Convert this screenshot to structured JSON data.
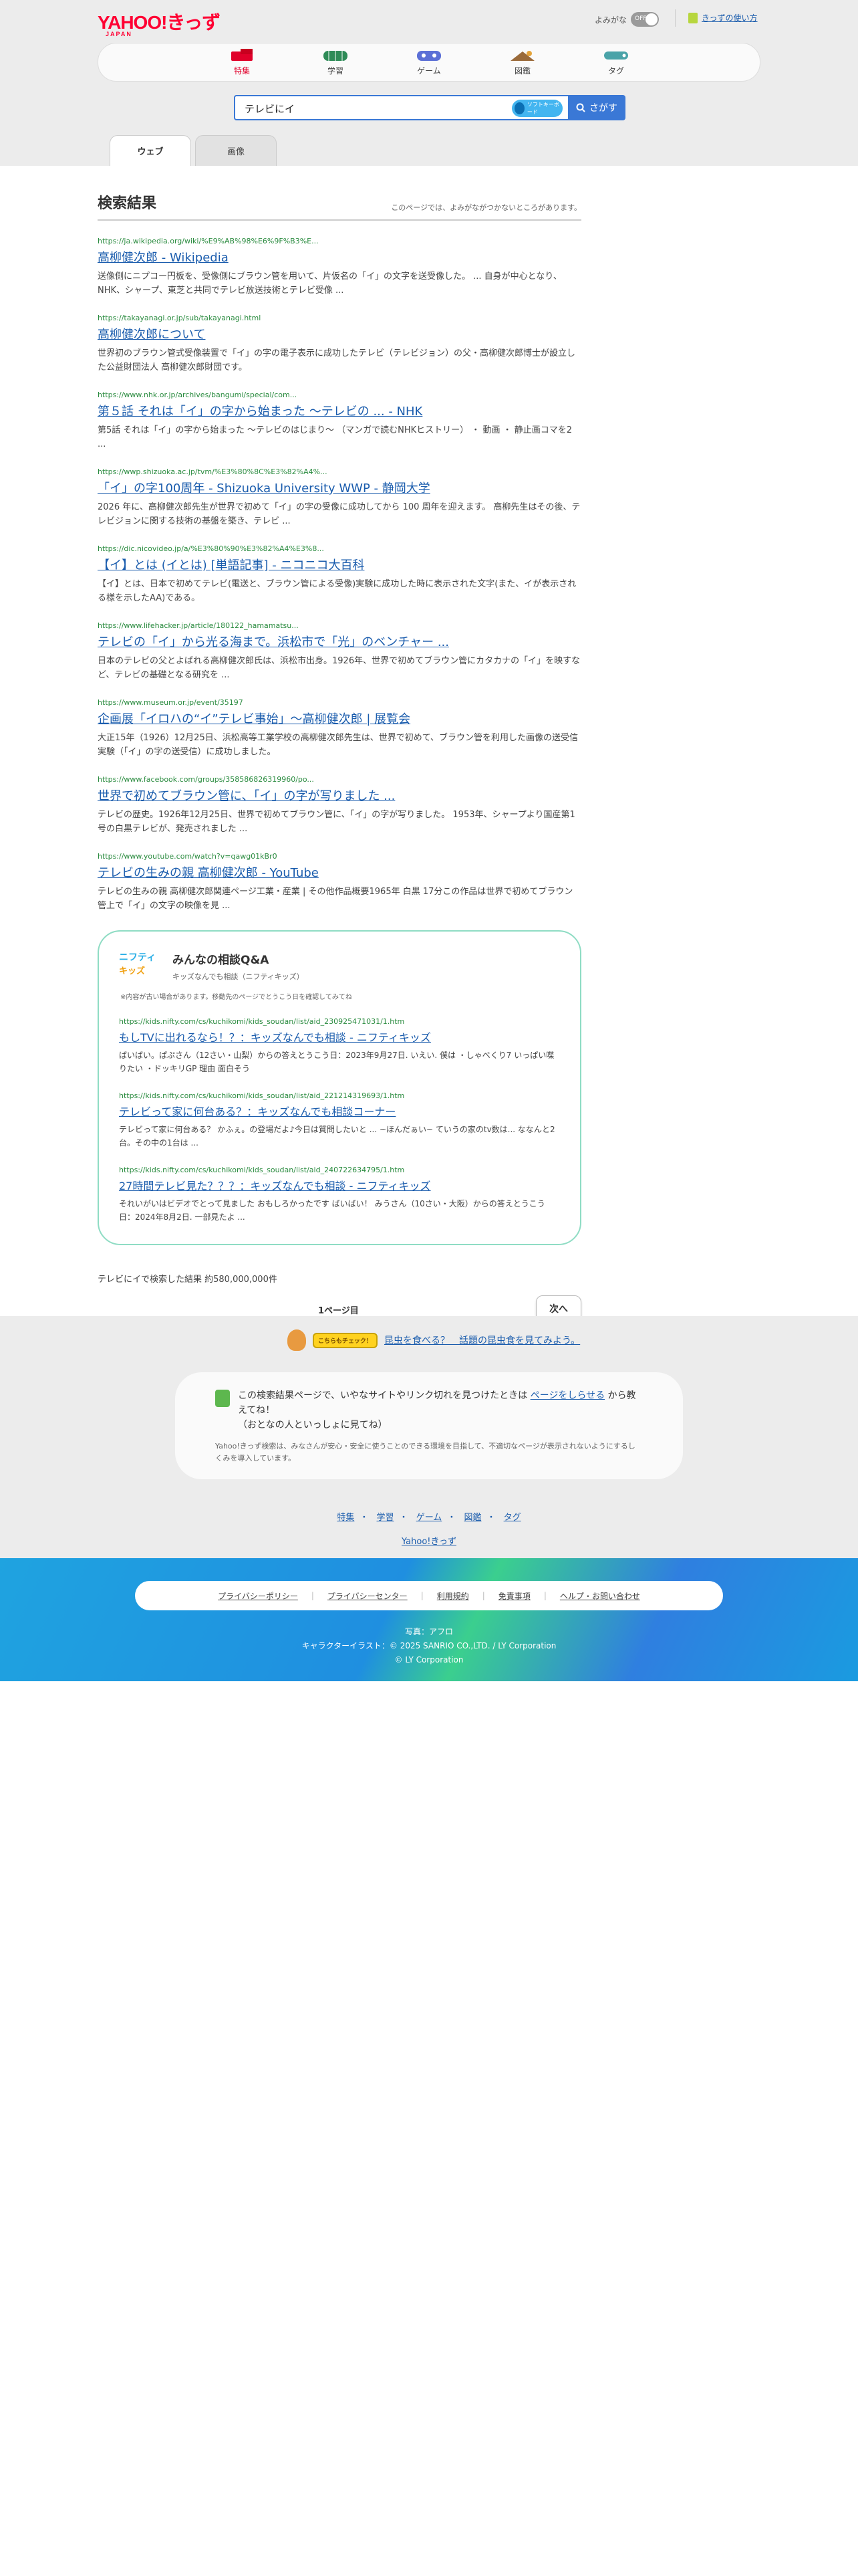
{
  "header": {
    "logo": "YAHOO!きっず",
    "logo_sub": "JAPAN",
    "furigana_label": "よみがな",
    "furigana_state": "OFF",
    "howto_label": "きっずの使い方",
    "categories": [
      {
        "label": "特集",
        "active": true
      },
      {
        "label": "学習",
        "active": false
      },
      {
        "label": "ゲーム",
        "active": false
      },
      {
        "label": "図鑑",
        "active": false
      },
      {
        "label": "タグ",
        "active": false
      }
    ]
  },
  "search": {
    "query": "テレビにイ",
    "keyboard_label": "ソフトキーボード",
    "button_label": "さがす"
  },
  "tabs": [
    "ウェブ",
    "画像"
  ],
  "results_header": {
    "title": "検索結果",
    "note": "このページでは、よみがながつかないところがあります。"
  },
  "results": [
    {
      "url": "https://ja.wikipedia.org/wiki/%E9%AB%98%E6%9F%B3%E...",
      "title": "高柳健次郎 - Wikipedia",
      "desc": "送像側にニプコー円板を、受像側にブラウン管を用いて、片仮名の「イ」の文字を送受像した。 ... 自身が中心となり、NHK、シャープ、東芝と共同でテレビ放送技術とテレビ受像 ..."
    },
    {
      "url": "https://takayanagi.or.jp/sub/takayanagi.html",
      "title": "高柳健次郎について",
      "desc": "世界初のブラウン管式受像装置で「イ」の字の電子表示に成功したテレビ（テレビジョン）の父・高柳健次郎博士が設立した公益財団法人 高柳健次郎財団です。"
    },
    {
      "url": "https://www.nhk.or.jp/archives/bangumi/special/com...",
      "title": "第５話 それは「イ」の字から始まった 〜テレビの ... - NHK",
      "desc": "第5話 それは「イ」の字から始まった 〜テレビのはじまり〜 （マンガで読むNHKヒストリー） ・ 動画 ・ 静止画コマを2 ..."
    },
    {
      "url": "https://wwp.shizuoka.ac.jp/tvm/%E3%80%8C%E3%82%A4%...",
      "title": "「イ」の字100周年 - Shizuoka University WWP - 静岡大学",
      "desc": "2026 年に、高柳健次郎先生が世界で初めて「イ」の字の受像に成功してから 100 周年を迎えます。 高柳先生はその後、テレビジョンに関する技術の基盤を築き、テレビ ..."
    },
    {
      "url": "https://dic.nicovideo.jp/a/%E3%80%90%E3%82%A4%E3%8...",
      "title": "【イ】とは (イとは) [単語記事] - ニコニコ大百科",
      "desc": "【イ】とは、日本で初めてテレビ(電送と、ブラウン管による受像)実験に成功した時に表示された文字(また、イが表示される様を示したAA)である。"
    },
    {
      "url": "https://www.lifehacker.jp/article/180122_hamamatsu...",
      "title": "テレビの「イ」から光る海まで。浜松市で「光」のベンチャー ...",
      "desc": "日本のテレビの父とよばれる高柳健次郎氏は、浜松市出身。1926年、世界で初めてブラウン管にカタカナの「イ」を映すなど、テレビの基礎となる研究を ..."
    },
    {
      "url": "https://www.museum.or.jp/event/35197",
      "title": "企画展「イロハの“イ”テレビ事始」〜高柳健次郎 | 展覧会",
      "desc": "大正15年（1926）12月25日、浜松高等工業学校の高柳健次郎先生は、世界で初めて、ブラウン管を利用した画像の送受信実験（「イ」の字の送受信）に成功しました。"
    },
    {
      "url": "https://www.facebook.com/groups/358586826319960/po...",
      "title": "世界で初めてブラウン管に、「イ」の字が写りました ...",
      "desc": "テレビの歴史。1926年12月25日、世界で初めてブラウン管に、「イ」の字が写りました。 1953年、シャープより国産第1号の白黒テレビが、発売されました ..."
    },
    {
      "url": "https://www.youtube.com/watch?v=qawg01kBr0",
      "title": "テレビの生みの親 高柳健次郎 - YouTube",
      "desc": "テレビの生みの親 高柳健次郎関連ページ工業・産業 | その他作品概要1965年 白黒 17分この作品は世界で初めてブラウン管上で「イ」の文字の映像を見 ..."
    }
  ],
  "qa": {
    "logo_top": "ニフティ",
    "logo_bottom": "キッズ",
    "title": "みんなの相談Q&A",
    "subtitle": "キッズなんでも相談（ニフティキッズ）",
    "warning": "※内容が古い場合があります。移動先のページでとうこう日を確認してみてね",
    "items": [
      {
        "url": "https://kids.nifty.com/cs/kuchikomi/kids_soudan/list/aid_230925471031/1.htm",
        "title": "もしTVに出れるなら！？：キッズなんでも相談 - ニフティキッズ",
        "desc": "ばいばい。ぱぷさん（12さい・山梨）からの答えとうこう日：2023年9月27日. いえい. 僕は ・しゃべくり7 いっぱい喋りたい ・ドッキリGP 理由 面白そう"
      },
      {
        "url": "https://kids.nifty.com/cs/kuchikomi/kids_soudan/list/aid_221214319693/1.htm",
        "title": "テレビって家に何台ある？：キッズなんでも相談コーナー",
        "desc": "テレビって家に何台ある？ かふぇ。の登場だよ♪今日は質問したいと ... ~ほんだぁい~ ていうの家のtv数は... ななんと2台。その中の1台は ..."
      },
      {
        "url": "https://kids.nifty.com/cs/kuchikomi/kids_soudan/list/aid_240722634795/1.htm",
        "title": "27時間テレビ見た？？？：キッズなんでも相談 - ニフティキッズ",
        "desc": "それいがいはビデオでとって見ました おもしろかったです ばいばい！ みうさん（10さい・大阪）からの答えとうこう日：2024年8月2日. 一部見たよ ..."
      }
    ]
  },
  "total": "テレビにイで検索した結果 約580,000,000件",
  "pager": {
    "current": "1ページ目",
    "next": "次へ"
  },
  "promo": {
    "badge": "こちらもチェック！",
    "text": "昆虫を食べる？　話題の昆虫食を見てみよう。"
  },
  "report": {
    "text_before": "この検索結果ページで、いやなサイトやリンク切れを見つけたときは",
    "link": "ページをしらせる",
    "text_after": "から教えてね！",
    "text_line2": "（おとなの人といっしょに見てね）",
    "fine": "Yahoo!きっず検索は、みなさんが安心・安全に使うことのできる環境を目指して、不適切なページが表示されないようにするしくみを導入しています。"
  },
  "footer_links": [
    "特集",
    "学習",
    "ゲーム",
    "図鑑",
    "タグ"
  ],
  "footer_home": "Yahoo!きっず",
  "footer_bar": [
    "プライバシーポリシー",
    "プライバシーセンター",
    "利用規約",
    "免責事項",
    "ヘルプ・お問い合わせ"
  ],
  "credits": [
    "写真：アフロ",
    "キャラクターイラスト：© 2025 SANRIO CO.,LTD. / LY Corporation",
    "© LY Corporation"
  ],
  "colors": {
    "link": "#1a5cad",
    "url": "#2a8b3f",
    "accent": "#3a78d6",
    "brand": "#ff0033",
    "qa_border": "#8fdcc4"
  }
}
